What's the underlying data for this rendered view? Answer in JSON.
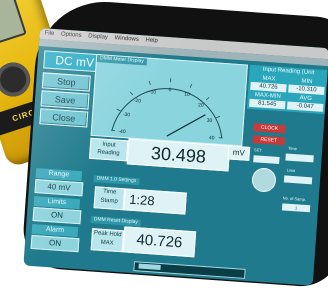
{
  "device": {
    "stripe_text": "CIRCUITS"
  },
  "menu": [
    "File",
    "Options",
    "Display",
    "Windows",
    "Help"
  ],
  "mode": {
    "label": "DC mV"
  },
  "buttons": {
    "stop": "Stop",
    "save": "Save",
    "close": "Close"
  },
  "range": {
    "label": "Range",
    "value": "40 mV"
  },
  "limits": {
    "label": "Limits",
    "value": "ON",
    "alarm_label": "Alarm",
    "alarm_value": "ON"
  },
  "dial": {
    "header": "DMM Meter Display",
    "ticks": [
      "-40",
      "-30",
      "-20",
      "-10",
      "0",
      "10",
      "20",
      "30",
      "40"
    ]
  },
  "reading": {
    "label": "Input Reading",
    "value": "30.498",
    "unit": "mV"
  },
  "time_panel": {
    "header": "DMM 1.0 Settings",
    "label": "Time Stamp",
    "value": "1:28"
  },
  "hold_panel": {
    "header": "DMM Reset Display",
    "label": "Peak Hold MAX",
    "value": "40.726"
  },
  "input_reading": {
    "title": "Input Reading (Unit",
    "max_label": "MAX",
    "max_value": "40.726",
    "min_label": "MIN",
    "min_value": "-10.310",
    "maxmin_label": "MAX-MIN",
    "maxmin_value": "81.545",
    "avg_label": "AVG",
    "avg_value": "-0.047"
  },
  "controls": {
    "clock_btn": "CLOCK",
    "reset_btn": "RESET",
    "set_label": "SET",
    "time_label": "Time",
    "limit_label": "Limit",
    "no_label": "No. of Samp.",
    "no_value": "1"
  }
}
